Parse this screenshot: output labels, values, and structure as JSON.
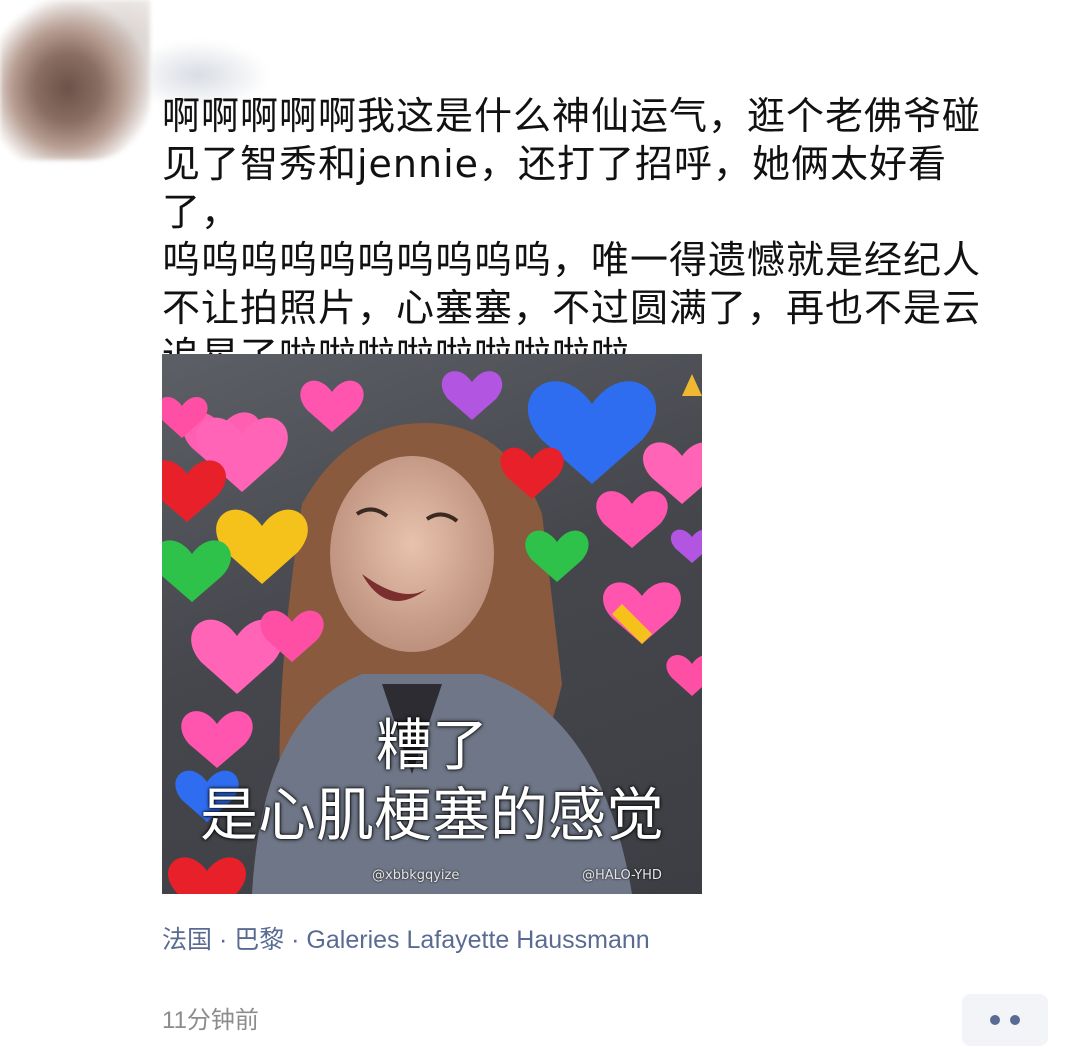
{
  "post": {
    "text": "啊啊啊啊啊我这是什么神仙运气，逛个老佛爷碰\n见了智秀和jennie，还打了招呼，她俩太好看了，\n呜呜呜呜呜呜呜呜呜呜，唯一得遗憾就是经纪人\n不让拍照片，心塞塞，不过圆满了，再也不是云\n追星了啦啦啦啦啦啦啦啦啦",
    "image": {
      "caption_line1": "糟了",
      "caption_line2": "是心肌梗塞的感觉",
      "watermark_left": "@xbbkgqyize",
      "watermark_right": "@HALO-YHD"
    },
    "location": "法国 · 巴黎 · Galeries Lafayette Haussmann",
    "timestamp": "11分钟前"
  },
  "actions": {
    "more_icon": "more-dots-icon"
  }
}
